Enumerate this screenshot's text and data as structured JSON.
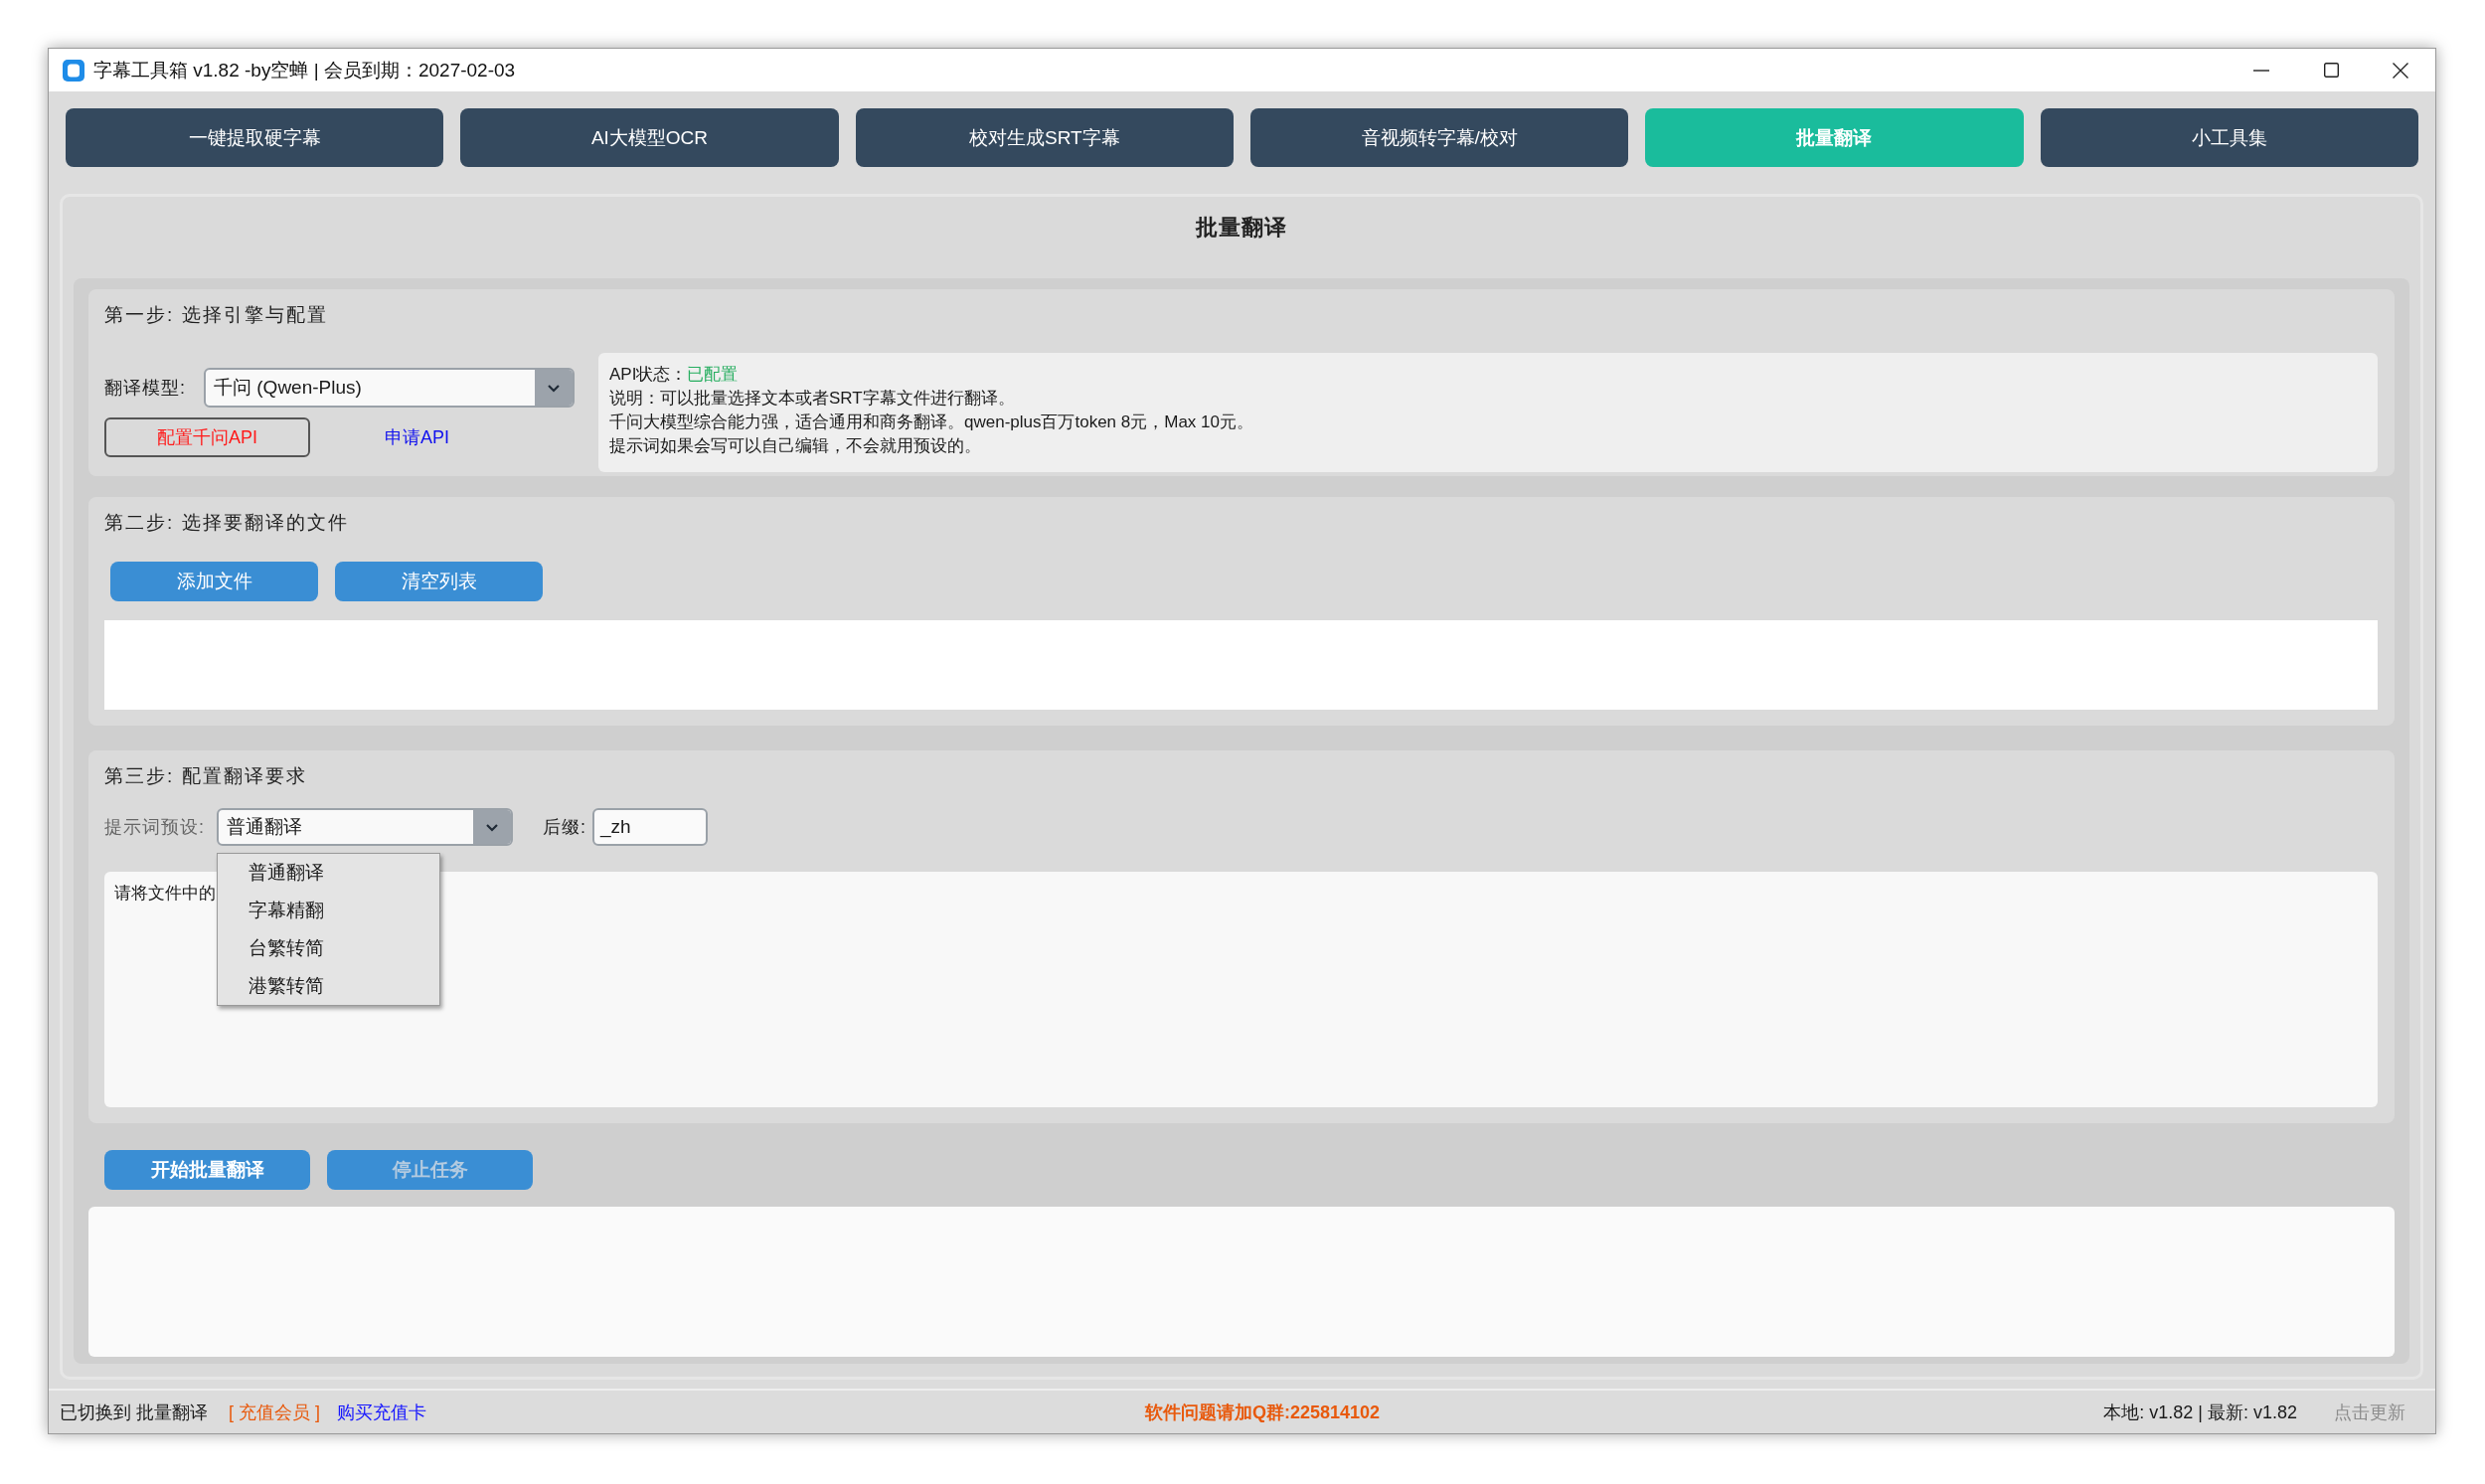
{
  "window": {
    "title": "字幕工具箱 v1.82 -by空蝉 | 会员到期：2027-02-03"
  },
  "tabs": [
    {
      "label": "一键提取硬字幕",
      "selected": false
    },
    {
      "label": "AI大模型OCR",
      "selected": false
    },
    {
      "label": "校对生成SRT字幕",
      "selected": false
    },
    {
      "label": "音视频转字幕/校对",
      "selected": false
    },
    {
      "label": "批量翻译",
      "selected": true
    },
    {
      "label": "小工具集",
      "selected": false
    }
  ],
  "page_title": "批量翻译",
  "step_1": {
    "heading": "第一步: 选择引擎与配置",
    "model_label": "翻译模型:",
    "model_select": {
      "value": "千问 (Qwen-Plus)"
    },
    "config_button": "配置千问API",
    "apply_link": "申请API",
    "info": {
      "status_label": "API状态：",
      "status_value": "已配置",
      "lines": [
        "说明：可以批量选择文本或者SRT字幕文件进行翻译。",
        "千问大模型综合能力强，适合通用和商务翻译。qwen-plus百万token 8元，Max 10元。",
        "提示词如果会写可以自己编辑，不会就用预设的。"
      ]
    }
  },
  "step_2": {
    "heading": "第二步: 选择要翻译的文件",
    "buttons": [
      "添加文件",
      "清空列表"
    ]
  },
  "step_3": {
    "heading": "第三步: 配置翻译要求",
    "preset_label": "提示词预设:",
    "preset_select": {
      "value": "普通翻译",
      "expanded": true,
      "options": [
        "普通翻译",
        "字幕精翻",
        "台繁转简",
        "港繁转简"
      ]
    },
    "suffix_label": "后缀:",
    "suffix_field": {
      "value": "_zh"
    },
    "prompt_text": "请将文件中的"
  },
  "actions": [
    {
      "label": "开始批量翻译",
      "disabled": false
    },
    {
      "label": "停止任务",
      "disabled": true
    }
  ],
  "status_bar": {
    "message": "已切换到 批量翻译",
    "recharge_link": "[ 充值会员 ]",
    "buy_link": "购买充值卡",
    "support": "软件问题请加Q群:225814102",
    "version": "本地: v1.82 | 最新: v1.82",
    "update_button": {
      "label": "点击更新",
      "disabled": true
    }
  }
}
